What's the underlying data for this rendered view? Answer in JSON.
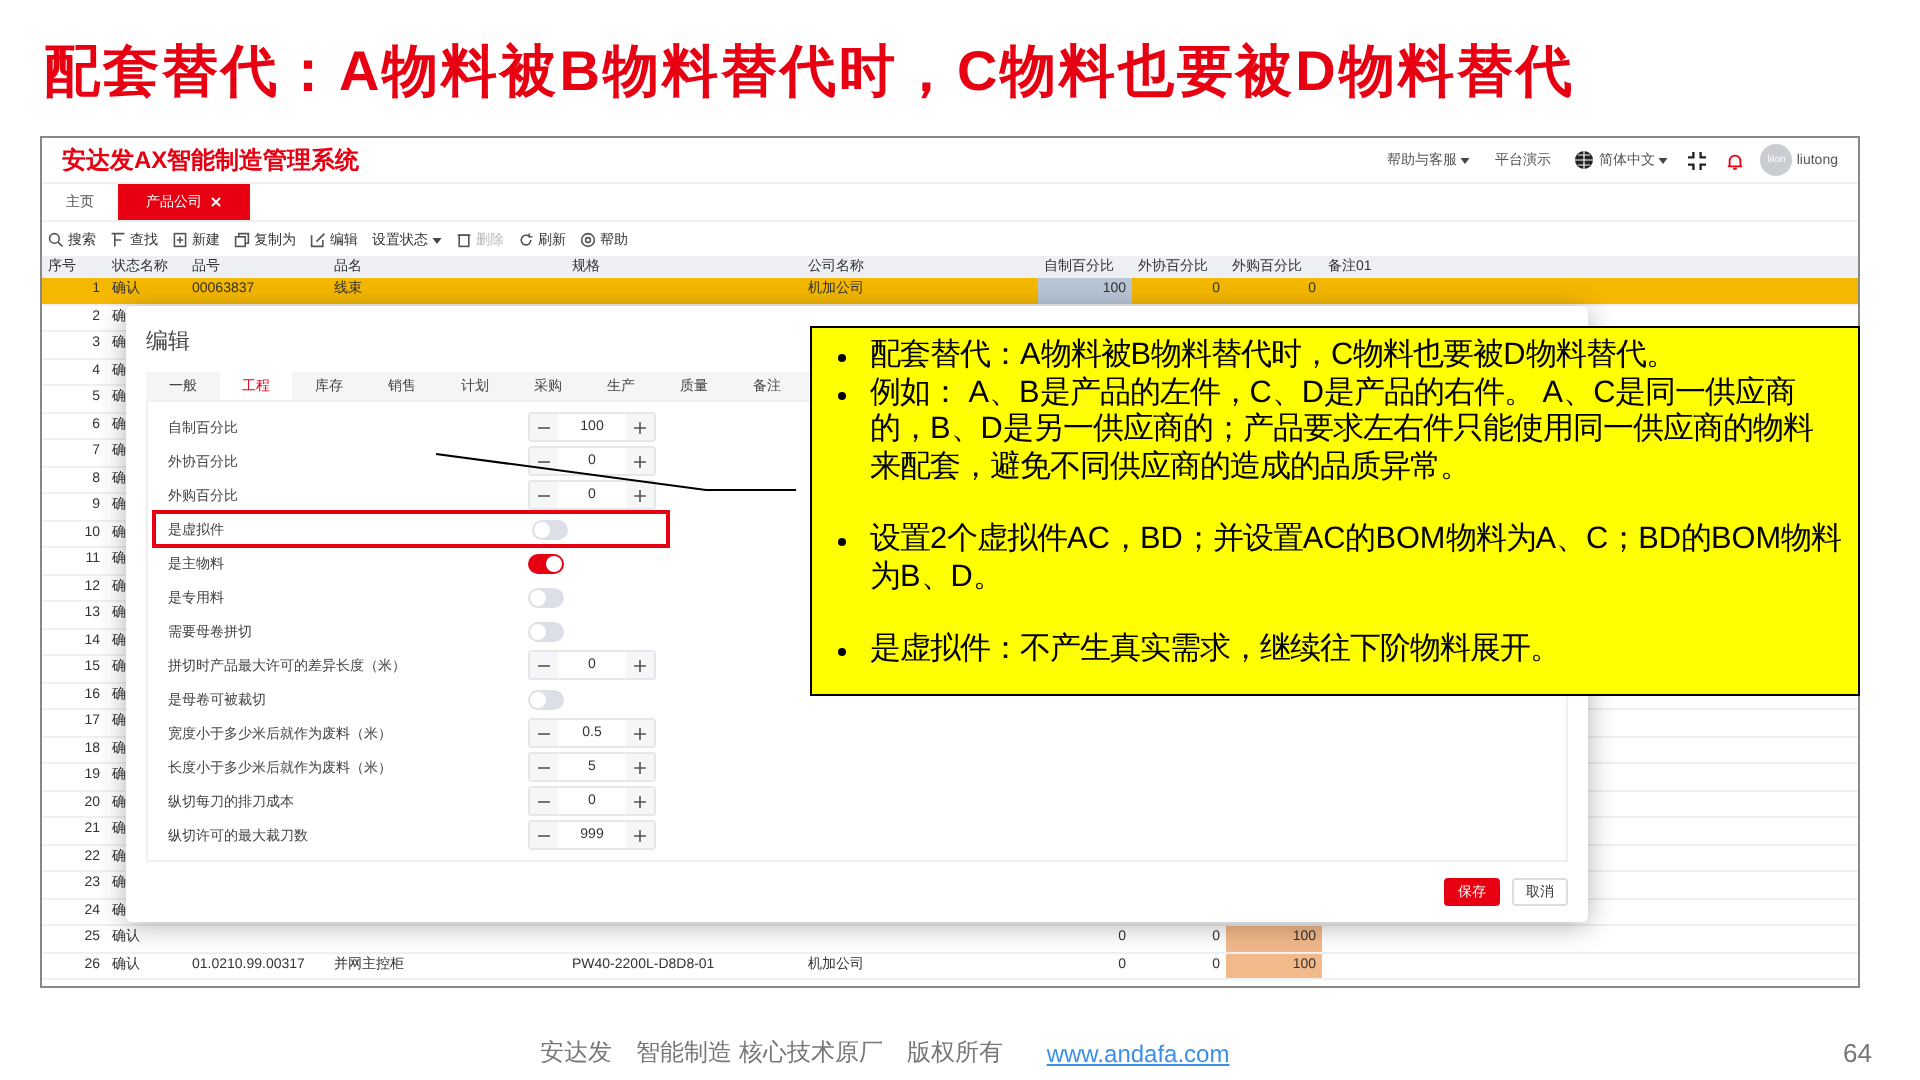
{
  "slide": {
    "title": "配套替代：A物料被B物料替代时，C物料也要被D物料替代",
    "footer_text": "安达发　智能制造 核心技术原厂　版权所有",
    "footer_link": "www.andafa.com",
    "page_number": "64"
  },
  "app": {
    "title": "安达发AX智能制造管理系统",
    "header_links": [
      {
        "label": "帮助与客服",
        "kind": "dropdown"
      },
      {
        "label": "平台演示",
        "kind": "link"
      },
      {
        "label": "简体中文",
        "kind": "language"
      }
    ],
    "user": {
      "avatar_text": "liton",
      "name": "liutong"
    }
  },
  "tabs": [
    {
      "label": "主页",
      "selected": false,
      "closable": false
    },
    {
      "label": "产品公司",
      "selected": true,
      "closable": true
    }
  ],
  "toolbar": [
    {
      "label": "搜索",
      "kind": "search",
      "disabled": false
    },
    {
      "label": "查找",
      "kind": "find",
      "disabled": false
    },
    {
      "label": "新建",
      "kind": "new",
      "disabled": false
    },
    {
      "label": "复制为",
      "kind": "copy",
      "disabled": false
    },
    {
      "label": "编辑",
      "kind": "edit",
      "disabled": false
    },
    {
      "label": "设置状态",
      "kind": "dropdown",
      "disabled": false
    },
    {
      "label": "删除",
      "kind": "delete",
      "disabled": true
    },
    {
      "label": "刷新",
      "kind": "refresh",
      "disabled": false
    },
    {
      "label": "帮助",
      "kind": "help",
      "disabled": false
    }
  ],
  "table": {
    "columns": [
      "序号",
      "状态名称",
      "品号",
      "品名",
      "规格",
      "公司名称",
      "自制百分比",
      "外协百分比",
      "外购百分比",
      "备注01"
    ],
    "rows": [
      {
        "seq": "1",
        "status": "确认",
        "code": "00063837",
        "name": "线束",
        "company": "机加公司",
        "make_pct": "100",
        "outsource_pct": "0",
        "purchase_pct": "0",
        "selected": true,
        "make_pct_focused": true
      },
      {
        "seq": "2",
        "status": "确",
        "selected": false
      },
      {
        "seq": "3",
        "status": "确",
        "selected": false
      },
      {
        "seq": "4",
        "status": "确",
        "selected": false
      },
      {
        "seq": "5",
        "status": "确",
        "selected": false
      },
      {
        "seq": "6",
        "status": "确",
        "selected": false
      },
      {
        "seq": "7",
        "status": "确",
        "selected": false
      },
      {
        "seq": "8",
        "status": "确",
        "selected": false
      },
      {
        "seq": "9",
        "status": "确",
        "selected": false
      },
      {
        "seq": "10",
        "status": "确",
        "selected": false
      },
      {
        "seq": "11",
        "status": "确",
        "selected": false
      },
      {
        "seq": "12",
        "status": "确",
        "selected": false
      },
      {
        "seq": "13",
        "status": "确",
        "selected": false
      },
      {
        "seq": "14",
        "status": "确",
        "selected": false
      },
      {
        "seq": "15",
        "status": "确",
        "selected": false
      },
      {
        "seq": "16",
        "status": "确",
        "selected": false
      },
      {
        "seq": "17",
        "status": "确",
        "selected": false
      },
      {
        "seq": "18",
        "status": "确",
        "selected": false
      },
      {
        "seq": "19",
        "status": "确",
        "selected": false
      },
      {
        "seq": "20",
        "status": "确",
        "selected": false
      },
      {
        "seq": "21",
        "status": "确",
        "selected": false
      },
      {
        "seq": "22",
        "status": "确",
        "selected": false
      },
      {
        "seq": "23",
        "status": "确",
        "selected": false
      },
      {
        "seq": "24",
        "status": "确",
        "selected": false
      },
      {
        "seq": "25",
        "status": "确认",
        "make_pct": "0",
        "outsource_pct": "0",
        "purchase_pct": "100",
        "selected": false,
        "purchase_pct_flagged": true
      },
      {
        "seq": "26",
        "status": "确认",
        "code": "01.0210.99.00317",
        "name": "并网主控柜",
        "spec": "PW40-2200L-D8D8-01",
        "company": "机加公司",
        "make_pct": "0",
        "outsource_pct": "0",
        "purchase_pct": "100",
        "selected": false,
        "purchase_pct_flagged": true
      }
    ]
  },
  "dialog": {
    "title": "编辑",
    "tabs": [
      {
        "label": "一般",
        "selected": false
      },
      {
        "label": "工程",
        "selected": true
      },
      {
        "label": "库存",
        "selected": false
      },
      {
        "label": "销售",
        "selected": false
      },
      {
        "label": "计划",
        "selected": false
      },
      {
        "label": "采购",
        "selected": false
      },
      {
        "label": "生产",
        "selected": false
      },
      {
        "label": "质量",
        "selected": false
      },
      {
        "label": "备注",
        "selected": false
      }
    ],
    "fields": [
      {
        "label": "自制百分比",
        "kind": "stepper",
        "value": "100",
        "highlighted": false
      },
      {
        "label": "外协百分比",
        "kind": "stepper",
        "value": "0",
        "highlighted": false
      },
      {
        "label": "外购百分比",
        "kind": "stepper",
        "value": "0",
        "highlighted": false
      },
      {
        "label": "是虚拟件",
        "kind": "switch",
        "on": false,
        "highlighted": true
      },
      {
        "label": "是主物料",
        "kind": "switch",
        "on": true,
        "highlighted": false
      },
      {
        "label": "是专用料",
        "kind": "switch",
        "on": false,
        "highlighted": false
      },
      {
        "label": "需要母卷拼切",
        "kind": "switch",
        "on": false,
        "highlighted": false
      },
      {
        "label": "拼切时产品最大许可的差异长度（米）",
        "kind": "stepper",
        "value": "0",
        "highlighted": false
      },
      {
        "label": "是母卷可被裁切",
        "kind": "switch",
        "on": false,
        "highlighted": false
      },
      {
        "label": "宽度小于多少米后就作为废料（米）",
        "kind": "stepper",
        "value": "0.5",
        "highlighted": false
      },
      {
        "label": "长度小于多少米后就作为废料（米）",
        "kind": "stepper",
        "value": "5",
        "highlighted": false
      },
      {
        "label": "纵切每刀的排刀成本",
        "kind": "stepper",
        "value": "0",
        "highlighted": false
      },
      {
        "label": "纵切许可的最大裁刀数",
        "kind": "stepper",
        "value": "999",
        "highlighted": false
      }
    ],
    "buttons": [
      {
        "label": "保存",
        "kind": "primary"
      },
      {
        "label": "取消",
        "kind": "secondary"
      }
    ]
  },
  "callout": {
    "bullet_groups": [
      [
        "配套替代：A物料被B物料替代时，C物料也要被D物料替代。",
        "例如： A、B是产品的左件，C、D是产品的右件。 A、C是同一供应商的，B、D是另一供应商的；产品要求左右件只能使用同一供应商的物料来配套，避免不同供应商的造成的品质异常。"
      ],
      [
        "设置2个虚拟件AC，BD；并设置AC的BOM物料为A、C；BD的BOM物料为B、D。"
      ],
      [
        "是虚拟件：不产生真实需求，继续往下阶物料展开。"
      ]
    ]
  }
}
